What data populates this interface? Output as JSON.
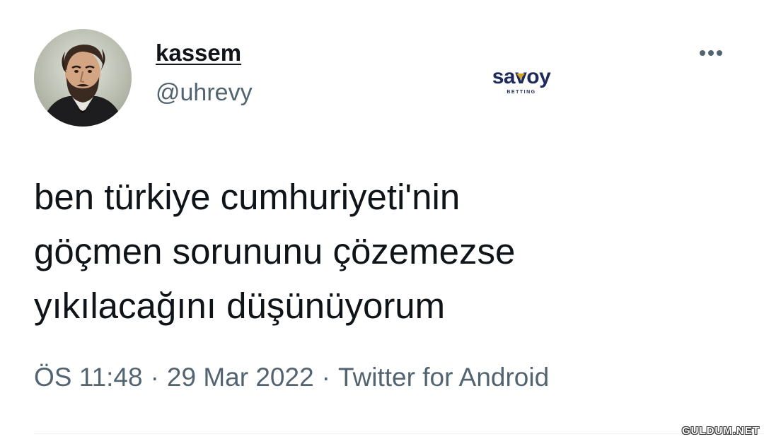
{
  "tweet": {
    "display_name": "kassem",
    "handle": "@uhrevy",
    "text_lines": [
      "ben türkiye cumhuriyeti'nin",
      "göçmen sorununu çözemezse",
      "yıkılacağını düşünüyorum"
    ],
    "time": "ÖS 11:48",
    "date": "29 Mar 2022",
    "source": "Twitter for Android",
    "separator": "·",
    "more_icon": "more-horizontal-icon"
  },
  "sponsor": {
    "brand": "savoy",
    "tagline": "BETTING",
    "brand_color": "#1f2a5c",
    "accent_color": "#d4a52a"
  },
  "watermark": "GULDUM.NET",
  "colors": {
    "text_primary": "#0f1419",
    "text_secondary": "#536471",
    "divider": "#eff3f4"
  }
}
